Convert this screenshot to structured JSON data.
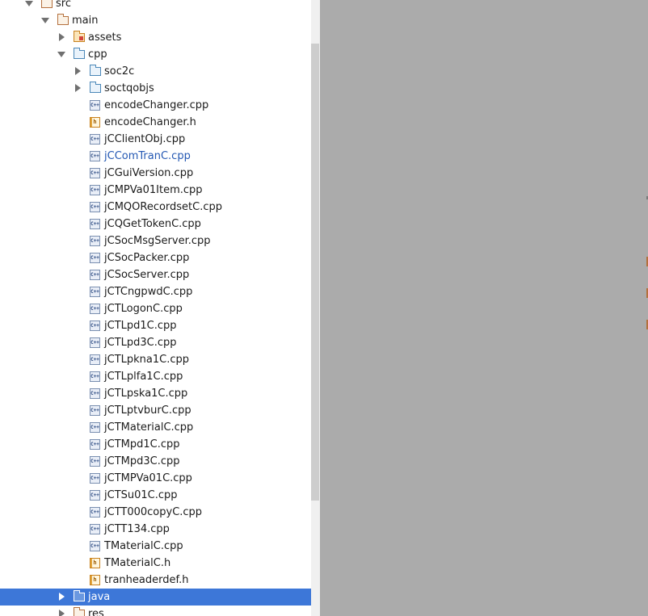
{
  "tree": {
    "src": "src",
    "main": "main",
    "assets": "assets",
    "cpp": "cpp",
    "subfolders": [
      "soc2c",
      "soctqobjs"
    ],
    "files": [
      {
        "name": "encodeChanger.cpp",
        "type": "cpp"
      },
      {
        "name": "encodeChanger.h",
        "type": "h"
      },
      {
        "name": "jCClientObj.cpp",
        "type": "cpp"
      },
      {
        "name": "jCComTranC.cpp",
        "type": "cpp"
      },
      {
        "name": "jCGuiVersion.cpp",
        "type": "cpp"
      },
      {
        "name": "jCMPVa01Item.cpp",
        "type": "cpp"
      },
      {
        "name": "jCMQORecordsetC.cpp",
        "type": "cpp"
      },
      {
        "name": "jCQGetTokenC.cpp",
        "type": "cpp"
      },
      {
        "name": "jCSocMsgServer.cpp",
        "type": "cpp"
      },
      {
        "name": "jCSocPacker.cpp",
        "type": "cpp"
      },
      {
        "name": "jCSocServer.cpp",
        "type": "cpp"
      },
      {
        "name": "jCTCngpwdC.cpp",
        "type": "cpp"
      },
      {
        "name": "jCTLogonC.cpp",
        "type": "cpp"
      },
      {
        "name": "jCTLpd1C.cpp",
        "type": "cpp"
      },
      {
        "name": "jCTLpd3C.cpp",
        "type": "cpp"
      },
      {
        "name": "jCTLpkna1C.cpp",
        "type": "cpp"
      },
      {
        "name": "jCTLplfa1C.cpp",
        "type": "cpp"
      },
      {
        "name": "jCTLpska1C.cpp",
        "type": "cpp"
      },
      {
        "name": "jCTLptvburC.cpp",
        "type": "cpp"
      },
      {
        "name": "jCTMaterialC.cpp",
        "type": "cpp"
      },
      {
        "name": "jCTMpd1C.cpp",
        "type": "cpp"
      },
      {
        "name": "jCTMpd3C.cpp",
        "type": "cpp"
      },
      {
        "name": "jCTMPVa01C.cpp",
        "type": "cpp"
      },
      {
        "name": "jCTSu01C.cpp",
        "type": "cpp"
      },
      {
        "name": "jCTT000copyC.cpp",
        "type": "cpp"
      },
      {
        "name": "jCTT134.cpp",
        "type": "cpp"
      },
      {
        "name": "TMaterialC.cpp",
        "type": "cpp"
      },
      {
        "name": "TMaterialC.h",
        "type": "h"
      },
      {
        "name": "tranheaderdef.h",
        "type": "h"
      }
    ],
    "java": "java",
    "res": "res",
    "hovered_file": "jCComTranC.cpp"
  },
  "icons": {
    "cpp_badge": "C++",
    "h_badge": "h",
    "expanded": "chevron-down-icon",
    "collapsed": "chevron-right-icon",
    "folder": "folder-icon"
  },
  "colors": {
    "selection": "#3d77d8",
    "link": "#2458b3",
    "right_pane": "#ababab"
  }
}
